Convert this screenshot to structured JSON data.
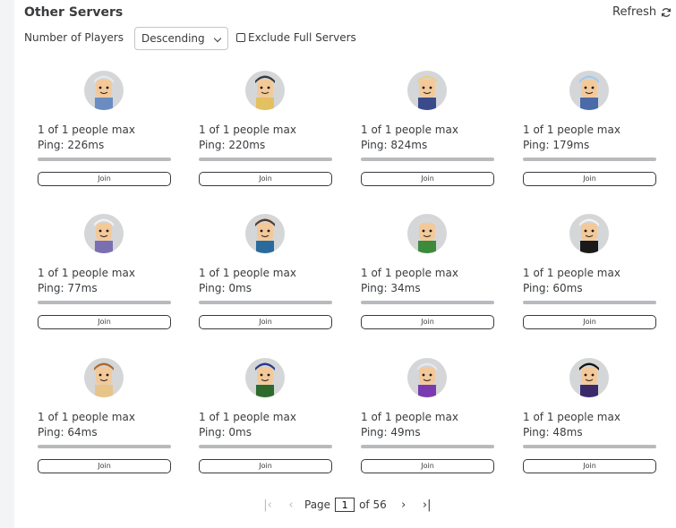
{
  "header": {
    "title": "Other Servers",
    "refresh_label": "Refresh"
  },
  "filters": {
    "sort_label": "Number of Players",
    "sort_value": "Descending",
    "exclude_full_label": "Exclude Full Servers",
    "exclude_full_checked": false
  },
  "servers": [
    {
      "players": "1 of 1 people max",
      "ping": "Ping: 226ms",
      "join_label": "Join",
      "fill": 1.0
    },
    {
      "players": "1 of 1 people max",
      "ping": "Ping: 220ms",
      "join_label": "Join",
      "fill": 1.0
    },
    {
      "players": "1 of 1 people max",
      "ping": "Ping: 824ms",
      "join_label": "Join",
      "fill": 1.0
    },
    {
      "players": "1 of 1 people max",
      "ping": "Ping: 179ms",
      "join_label": "Join",
      "fill": 1.0
    },
    {
      "players": "1 of 1 people max",
      "ping": "Ping: 77ms",
      "join_label": "Join",
      "fill": 1.0
    },
    {
      "players": "1 of 1 people max",
      "ping": "Ping: 0ms",
      "join_label": "Join",
      "fill": 1.0
    },
    {
      "players": "1 of 1 people max",
      "ping": "Ping: 34ms",
      "join_label": "Join",
      "fill": 1.0
    },
    {
      "players": "1 of 1 people max",
      "ping": "Ping: 60ms",
      "join_label": "Join",
      "fill": 1.0
    },
    {
      "players": "1 of 1 people max",
      "ping": "Ping: 64ms",
      "join_label": "Join",
      "fill": 1.0
    },
    {
      "players": "1 of 1 people max",
      "ping": "Ping: 0ms",
      "join_label": "Join",
      "fill": 1.0
    },
    {
      "players": "1 of 1 people max",
      "ping": "Ping: 49ms",
      "join_label": "Join",
      "fill": 1.0
    },
    {
      "players": "1 of 1 people max",
      "ping": "Ping: 48ms",
      "join_label": "Join",
      "fill": 1.0
    }
  ],
  "pagination": {
    "page_label": "Page",
    "current_page": "1",
    "of_label": "of 56"
  },
  "colors": {
    "text": "#393b3d",
    "bar": "#c3c5c7",
    "avatar_bg": "#d4d6d8"
  }
}
